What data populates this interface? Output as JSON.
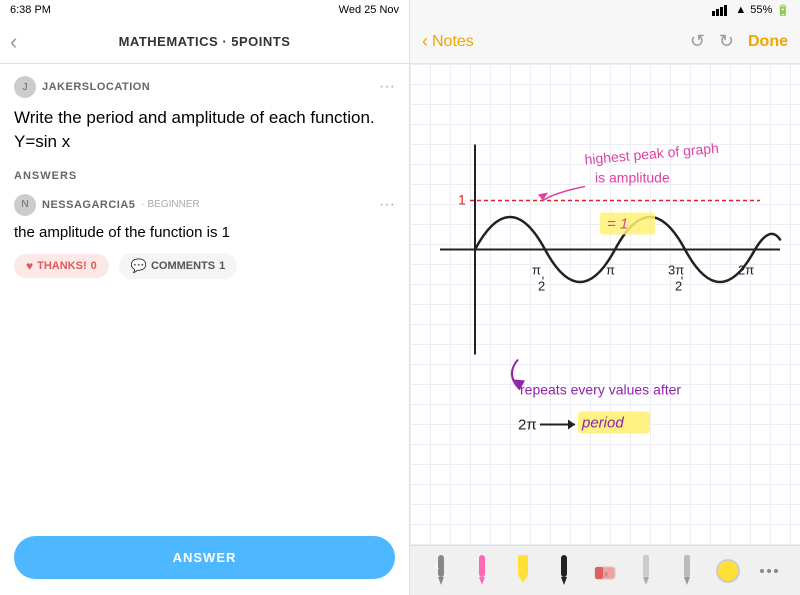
{
  "left": {
    "status_time": "6:38 PM",
    "status_date": "Wed 25 Nov",
    "nav_back": "‹",
    "nav_title": "MATHEMATICS · 5POINTS",
    "question_user_avatar": "J",
    "question_username": "JAKERSLOCATION",
    "question_more": "···",
    "question_text": "Write the period and amplitude of each function.",
    "question_formula": "Y=sin x",
    "answers_label": "ANSWERS",
    "answer_username": "NESSAGARCIA5",
    "answer_badge": "· BEGINNER",
    "answer_more": "···",
    "answer_text": "the amplitude of the function is 1",
    "thanks_label": "THANKS!",
    "thanks_count": "0",
    "comments_label": "COMMENTS",
    "comments_count": "1",
    "answer_button": "ANSWER"
  },
  "right": {
    "status_signal": "●●●",
    "status_wifi": "▲",
    "status_battery": "55%",
    "back_label": "Notes",
    "done_label": "Done",
    "undo_icon": "↺",
    "redo_icon": "↻",
    "toolbar": {
      "tools": [
        "pencil-a",
        "pen-pink",
        "pen-yellow",
        "pen-black",
        "eraser",
        "pencil-light",
        "pencil-light2",
        "color-yellow",
        "more"
      ]
    },
    "handwriting": {
      "annotation1": "highest peak of graph\nis amplitude",
      "annotation2": "= 1",
      "annotation3": "repeats every values after",
      "annotation4": "27π ← period",
      "axis_1": "1",
      "axis_pi_half": "π/2",
      "axis_pi": "π",
      "axis_3pi_half": "3π/2",
      "axis_2pi": "2π"
    }
  }
}
